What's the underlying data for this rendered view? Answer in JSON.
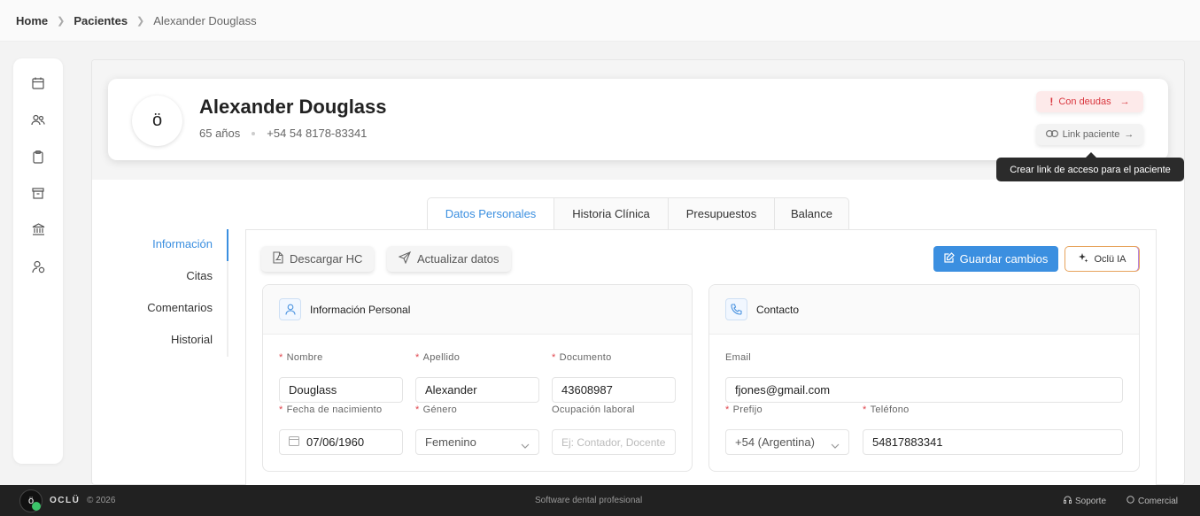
{
  "breadcrumb": [
    "Home",
    "Pacientes",
    "Alexander Douglass"
  ],
  "patient": {
    "avatar": "ö",
    "name": "Alexander Douglass",
    "age": "65 años",
    "phone": "+54 54 8178-83341"
  },
  "actions": {
    "debt_label": "Con deudas",
    "link_label": "Link paciente",
    "tooltip": "Crear link de acceso para el paciente"
  },
  "tabs": [
    "Datos Personales",
    "Historia Clínica",
    "Presupuestos",
    "Balance"
  ],
  "subnav": [
    "Información",
    "Citas",
    "Comentarios",
    "Historial"
  ],
  "toolbar": {
    "download": "Descargar HC",
    "update": "Actualizar datos",
    "save": "Guardar cambios",
    "ai": "Oclü IA"
  },
  "personal": {
    "title": "Información Personal",
    "nombre_label": "Nombre",
    "nombre": "Douglass",
    "apellido_label": "Apellido",
    "apellido": "Alexander",
    "documento_label": "Documento",
    "documento": "43608987",
    "fecha_label": "Fecha de nacimiento",
    "fecha": "07/06/1960",
    "genero_label": "Género",
    "genero": "Femenino",
    "ocupacion_label": "Ocupación laboral",
    "ocupacion_placeholder": "Ej: Contador, Docente"
  },
  "contact": {
    "title": "Contacto",
    "email_label": "Email",
    "email": "fjones@gmail.com",
    "prefijo_label": "Prefijo",
    "prefijo": "+54 (Argentina)",
    "telefono_label": "Teléfono",
    "telefono": "54817883341"
  },
  "footer": {
    "brand": "OCLÜ",
    "copyright": "© 2026",
    "tagline": "Software dental profesional",
    "support": "Soporte",
    "sales": "Comercial"
  },
  "colors": {
    "accent": "#3b8fe0",
    "danger": "#d9363e",
    "footer_bg": "#212121"
  }
}
